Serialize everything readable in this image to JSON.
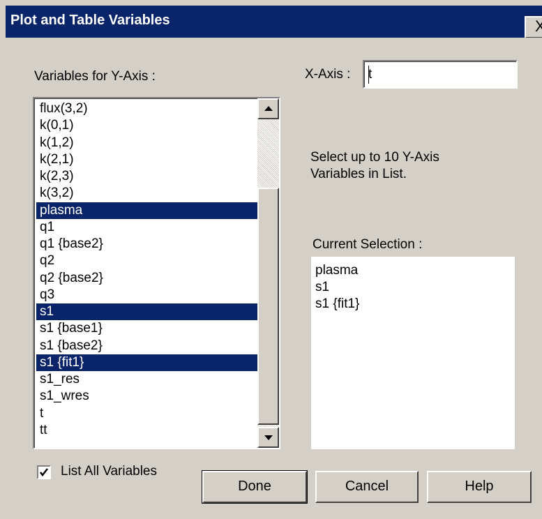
{
  "window": {
    "title": "Plot and Table Variables",
    "close_label": "X"
  },
  "yaxis": {
    "label": "Variables for Y-Axis :",
    "items": [
      {
        "label": "flux(3,2)",
        "selected": false
      },
      {
        "label": "k(0,1)",
        "selected": false
      },
      {
        "label": "k(1,2)",
        "selected": false
      },
      {
        "label": "k(2,1)",
        "selected": false
      },
      {
        "label": "k(2,3)",
        "selected": false
      },
      {
        "label": "k(3,2)",
        "selected": false
      },
      {
        "label": "plasma",
        "selected": true
      },
      {
        "label": "q1",
        "selected": false
      },
      {
        "label": "q1 {base2}",
        "selected": false
      },
      {
        "label": "q2",
        "selected": false
      },
      {
        "label": "q2 {base2}",
        "selected": false
      },
      {
        "label": "q3",
        "selected": false
      },
      {
        "label": "s1",
        "selected": true
      },
      {
        "label": "s1 {base1}",
        "selected": false
      },
      {
        "label": "s1 {base2}",
        "selected": false
      },
      {
        "label": "s1 {fit1}",
        "selected": true
      },
      {
        "label": "s1_res",
        "selected": false
      },
      {
        "label": "s1_wres",
        "selected": false
      },
      {
        "label": "t",
        "selected": false
      },
      {
        "label": "tt",
        "selected": false
      }
    ]
  },
  "xaxis": {
    "label": "X-Axis :",
    "value": "t"
  },
  "instructions": {
    "line1": "Select up to 10 Y-Axis",
    "line2": "Variables in List."
  },
  "current_selection": {
    "label": "Current Selection :",
    "items": [
      "plasma",
      "s1",
      "s1 {fit1}"
    ]
  },
  "list_all": {
    "label": "List All Variables",
    "checked": true
  },
  "buttons": {
    "done": "Done",
    "cancel": "Cancel",
    "help": "Help"
  },
  "colors": {
    "title_bar": "#0a246a",
    "dialog_face": "#d4d0c8",
    "selection_highlight": "#0a246a"
  }
}
